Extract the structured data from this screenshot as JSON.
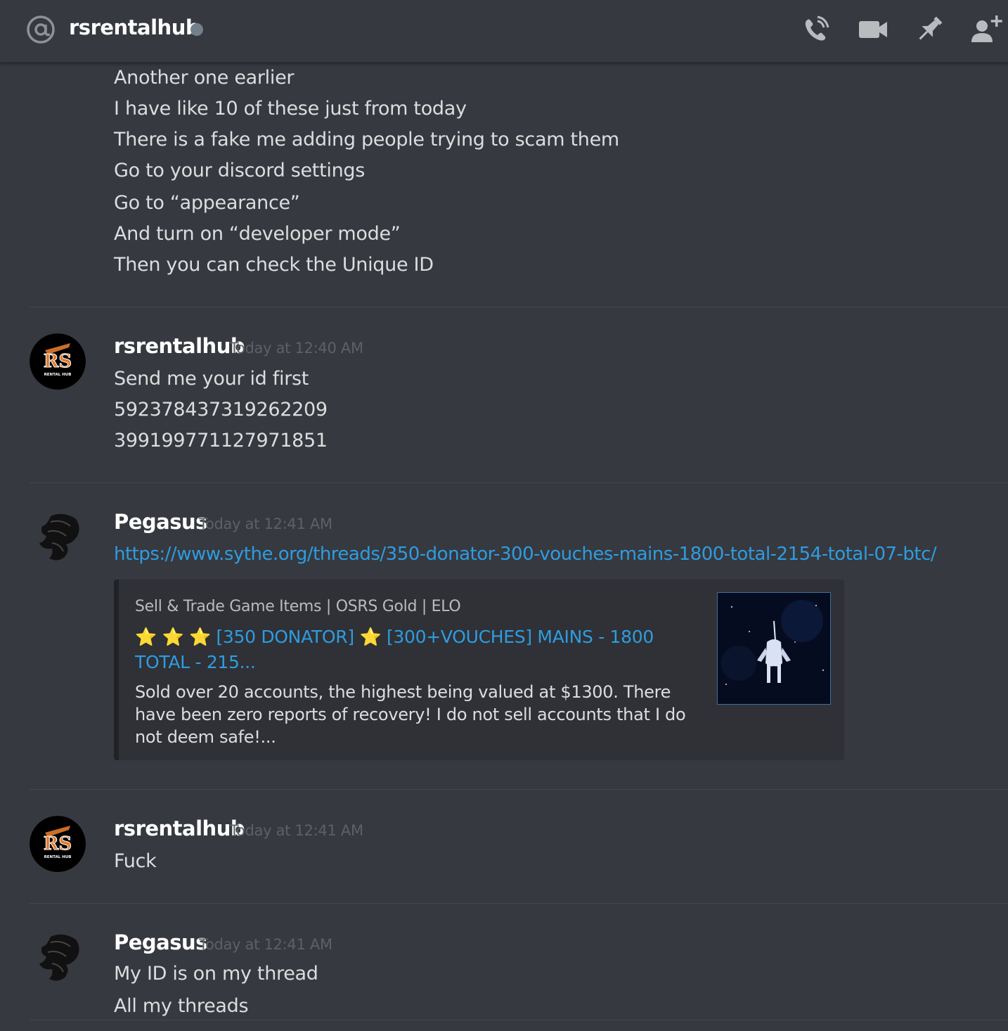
{
  "header": {
    "channel_name": "rsrentalhub",
    "status": "offline",
    "icons": [
      "at-icon",
      "phone-call-icon",
      "video-camera-icon",
      "pin-icon",
      "add-friend-icon"
    ]
  },
  "messages": {
    "continued_lines": [
      "Another one earlier",
      "I have like 10 of these just from today",
      "There is a fake me adding people trying to scam them",
      "Go to your discord settings",
      "Go to “appearance”",
      "And turn on “developer mode”",
      "Then you can check the Unique ID"
    ],
    "group1": {
      "author": "rsrentalhub",
      "timestamp": "Today at 12:40 AM",
      "lines": [
        "Send me your id first",
        "592378437319262209",
        "399199771127971851"
      ]
    },
    "group2": {
      "author": "Pegasus",
      "timestamp": "Today at 12:41 AM",
      "link": "https://www.sythe.org/threads/350-donator-300-vouches-mains-1800-total-2154-total-07-btc/",
      "embed": {
        "provider": "Sell & Trade Game Items | OSRS Gold | ELO",
        "title_stars_lead": "⭐ ⭐ ⭐ ",
        "title_part1": "[350 DONATOR]",
        "title_stars_mid": " ⭐ ",
        "title_part2": "[300+VOUCHES] MAINS - 1800 TOTAL - 215...",
        "description": "Sold over 20 accounts, the highest being valued at $1300. There have been zero reports of recovery! I do not sell accounts that I do not deem safe!..."
      }
    },
    "group3": {
      "author": "rsrentalhub",
      "timestamp": "Today at 12:41 AM",
      "lines": [
        "Fuck"
      ]
    },
    "group4": {
      "author": "Pegasus",
      "timestamp": "Today at 12:41 AM",
      "lines": [
        "My ID is on my thread",
        "All my threads"
      ]
    }
  },
  "avatars": {
    "rsrentalhub_logo_text": "RS",
    "rsrentalhub_logo_subtext": "RENTAL HUB"
  },
  "colors": {
    "background": "#36393f",
    "link": "#2f9ce0",
    "status_offline": "#747f8d",
    "logo_orange": "#e07a2c"
  }
}
